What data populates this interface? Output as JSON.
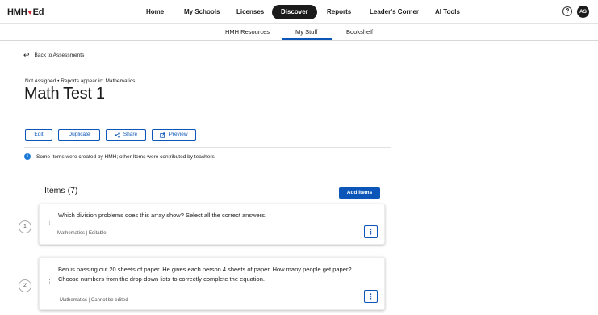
{
  "topnav": {
    "logo_left": "HMH",
    "logo_right": "Ed",
    "items": [
      "Home",
      "My Schools",
      "Licenses",
      "Discover",
      "Reports",
      "Leader's Corner",
      "AI Tools"
    ],
    "active": "Discover",
    "help_label": "?",
    "avatar_initials": "AS"
  },
  "subnav": {
    "items": [
      "HMH Resources",
      "My Stuff",
      "Bookshelf"
    ],
    "active": "My Stuff"
  },
  "back_link": "Back to Assessments",
  "meta_line": "Not Assigned • Reports appear in: Mathematics",
  "page_title": "Math Test 1",
  "actions": {
    "edit": "Edit",
    "duplicate": "Duplicate",
    "share": "Share",
    "preview": "Preview"
  },
  "info_text": "Some Items were created by HMH; other Items were contributed by teachers.",
  "items_heading": "Items (7)",
  "add_items_label": "Add Items",
  "items": [
    {
      "number": "1",
      "text": "Which division problems does this array show? Select all the correct answers.",
      "meta": "Mathematics | Editable"
    },
    {
      "number": "2",
      "text": "Ben is passing out 20 sheets of paper. He gives each person 4 sheets of paper. How many people get paper? Choose numbers from the drop-down lists to correctly complete the equation.",
      "meta": "Mathematics | Cannot be edited"
    }
  ],
  "colors": {
    "accent": "#0b56b8",
    "brand_heart": "#d4262e",
    "nav_active_bg": "#1b1b1b",
    "info_icon": "#1e7bd8"
  }
}
